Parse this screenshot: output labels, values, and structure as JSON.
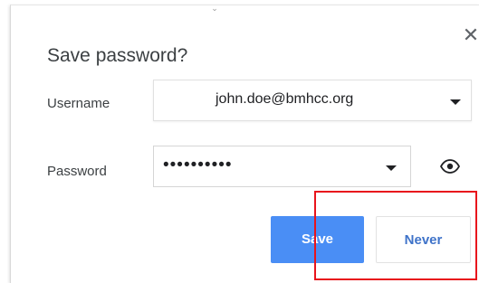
{
  "dialog": {
    "title": "Save password?",
    "close_icon": "close-icon",
    "close_glyph": "✕"
  },
  "form": {
    "username": {
      "label": "Username",
      "value": "john.doe@bmhcc.org"
    },
    "password": {
      "label": "Password",
      "value": "••••••••••",
      "reveal_icon": "eye-icon"
    }
  },
  "actions": {
    "save_label": "Save",
    "never_label": "Never"
  },
  "annotation": {
    "highlight_color": "#e8141c"
  },
  "colors": {
    "primary": "#4a8ef5",
    "link_blue": "#3f73c9"
  }
}
